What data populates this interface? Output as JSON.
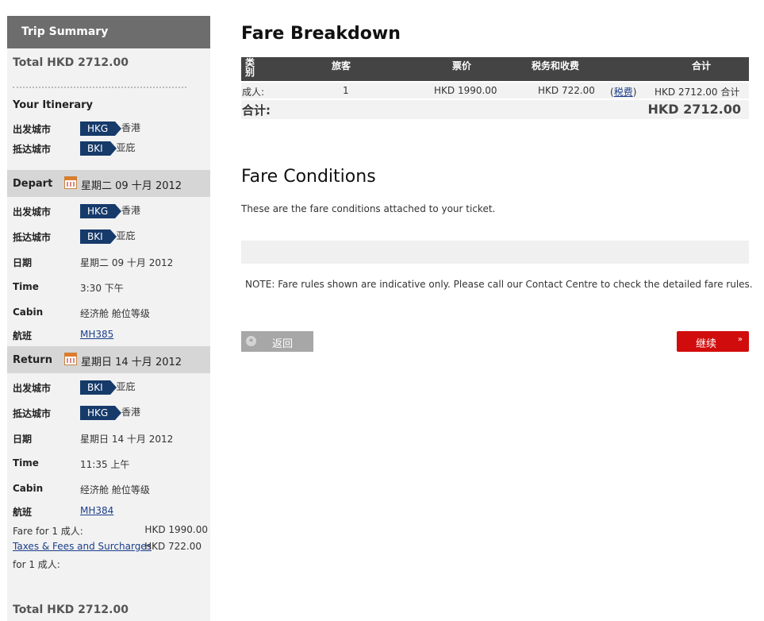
{
  "sidebar": {
    "header": "Trip Summary",
    "total": "Total HKD 2712.00",
    "itinerary_title": "Your Itinerary",
    "itinerary": [
      {
        "label": "出发城市",
        "code": "HKG",
        "city": "香港"
      },
      {
        "label": "抵达城市",
        "code": "BKI",
        "city": "亚庇"
      }
    ],
    "depart": {
      "title": "Depart",
      "date": "星期二 09 十月 2012",
      "from_label": "出发城市",
      "from_code": "HKG",
      "from_city": "香港",
      "to_label": "抵达城市",
      "to_code": "BKI",
      "to_city": "亚庇",
      "date_label": "日期",
      "date_value": "星期二 09 十月 2012",
      "time_label": "Time",
      "time_value": "3:30 下午",
      "cabin_label": "Cabin",
      "cabin_value": "经济舱 舱位等级",
      "flight_label": "航班",
      "flight_value": "MH385"
    },
    "return": {
      "title": "Return",
      "date": "星期日 14 十月 2012",
      "from_label": "出发城市",
      "from_code": "BKI",
      "from_city": "亚庇",
      "to_label": "抵达城市",
      "to_code": "HKG",
      "to_city": "香港",
      "date_label": "日期",
      "date_value": "星期日 14 十月 2012",
      "time_label": "Time",
      "time_value": "11:35 上午",
      "cabin_label": "Cabin",
      "cabin_value": "经济舱 舱位等级",
      "flight_label": "航班",
      "flight_value": "MH384"
    },
    "fare_label": "Fare for 1 成人:",
    "fare_value": "HKD 1990.00",
    "taxes_link": "Taxes & Fees and Surcharges",
    "taxes_value": "HKD 722.00",
    "taxes_for": "for 1 成人:",
    "bottom_total": "Total HKD 2712.00"
  },
  "fare_breakdown": {
    "title": "Fare Breakdown",
    "headers": {
      "type_line1": "类",
      "type_line2": "别",
      "passengers": "旅客",
      "fare": "票价",
      "taxes": "税务和收费",
      "total": "合计"
    },
    "row": {
      "type": "成人:",
      "count": "1",
      "fare": "HKD 1990.00",
      "taxes": "HKD 722.00",
      "tax_link": "税费",
      "total": "HKD 2712.00 合计"
    },
    "total_label": "合计:",
    "total_value": "HKD 2712.00"
  },
  "conditions": {
    "title": "Fare Conditions",
    "text": "These are the fare conditions attached to your ticket.",
    "note": "NOTE: Fare rules shown are indicative only. Please call our Contact Centre to check the detailed fare rules."
  },
  "buttons": {
    "back": "返回",
    "continue": "继续"
  }
}
